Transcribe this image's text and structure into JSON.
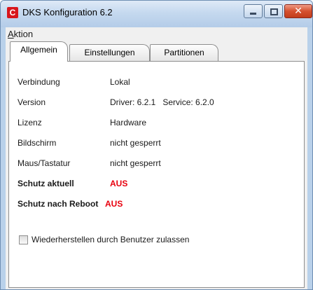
{
  "window": {
    "title": "DKS Konfiguration 6.2",
    "app_icon_letter": "C",
    "accent_red": "#d8161c"
  },
  "menu": {
    "items": [
      {
        "label_underlined": "A",
        "label_rest": "ktion"
      }
    ]
  },
  "tabs": [
    {
      "label": "Allgemein",
      "active": true
    },
    {
      "label": "Einstellungen",
      "active": false
    },
    {
      "label": "Partitionen",
      "active": false
    }
  ],
  "info": {
    "rows": [
      {
        "label": "Verbindung",
        "value": "Lokal"
      },
      {
        "label": "Version",
        "value": "Driver: 6.2.1   Service: 6.2.0"
      },
      {
        "label": "Lizenz",
        "value": "Hardware"
      },
      {
        "label": "Bildschirm",
        "value": "nicht gesperrt"
      },
      {
        "label": "Maus/Tastatur",
        "value": "nicht gesperrt"
      },
      {
        "label": "Schutz aktuell",
        "value": "AUS"
      },
      {
        "label": "Schutz nach Reboot",
        "value": "AUS"
      }
    ],
    "status_color": "#e8000e"
  },
  "options": {
    "restore_by_user_label": "Wiederherstellen durch Benutzer zulassen",
    "restore_by_user_checked": false
  }
}
